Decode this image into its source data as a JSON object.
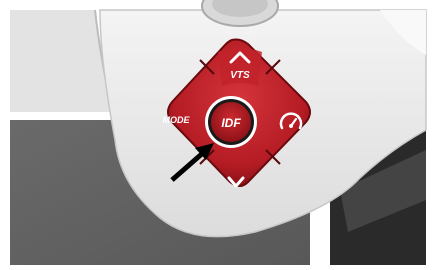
{
  "controls": {
    "top_label": "VTS",
    "left_label": "MODE",
    "center_label": "IDF",
    "top_icon": "chevron-up-icon",
    "bottom_icon": "chevron-down-icon",
    "right_icon": "speedometer-icon"
  },
  "callout": {
    "icon": "arrow-pointer-icon"
  },
  "colors": {
    "button_red": "#b51c24",
    "button_dark_red": "#7c0d12",
    "housing": "#ededed",
    "floor": "#616161",
    "frame": "#2a2a2a"
  }
}
